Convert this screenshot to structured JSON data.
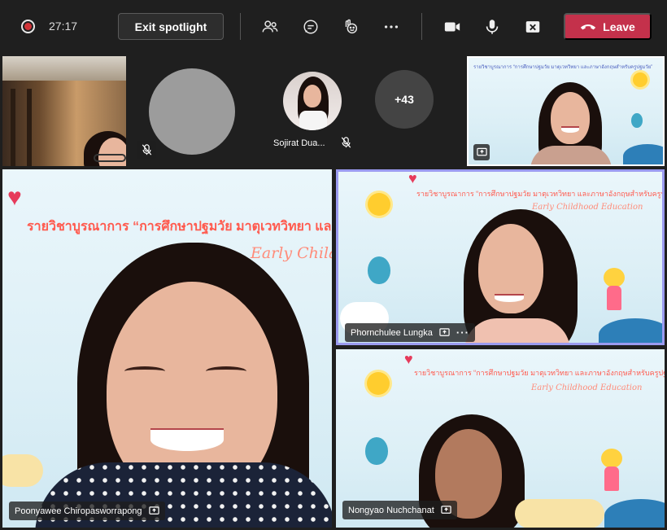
{
  "toolbar": {
    "timer": "27:17",
    "exit_spotlight_label": "Exit spotlight",
    "leave_label": "Leave",
    "icons": [
      "record-icon",
      "people-icon",
      "chat-icon",
      "react-icon",
      "more-icon",
      "camera-icon",
      "mic-icon",
      "share-icon",
      "phone-icon"
    ]
  },
  "participants_row": {
    "named_participant": "Sojirat Dua...",
    "overflow_count": "+43"
  },
  "slide": {
    "title": "รายวิชาบูรณาการ “การศึกษาปฐมวัย มาตุเวทวิทยา และภาษาอังกฤษสำหรับครูปฐมวัย”",
    "title_main_truncated": "รายวิชาบูรณาการ “การศึกษาปฐมวัย มาตุเวทวิทยา และภ",
    "subtitle": "Early Childhood Education",
    "subtitle_main_truncated": "Early Chila"
  },
  "tiles": {
    "main": {
      "name": "Poonyawee Chiropasworrapong"
    },
    "right_top": {
      "name": "Phornchulee Lungka"
    },
    "right_bottom": {
      "name": "Nongyao Nuchchanat"
    }
  },
  "colors": {
    "leave": "#c4314b",
    "active_border": "#9b9bf0",
    "slide_title": "#ff5a4e"
  }
}
